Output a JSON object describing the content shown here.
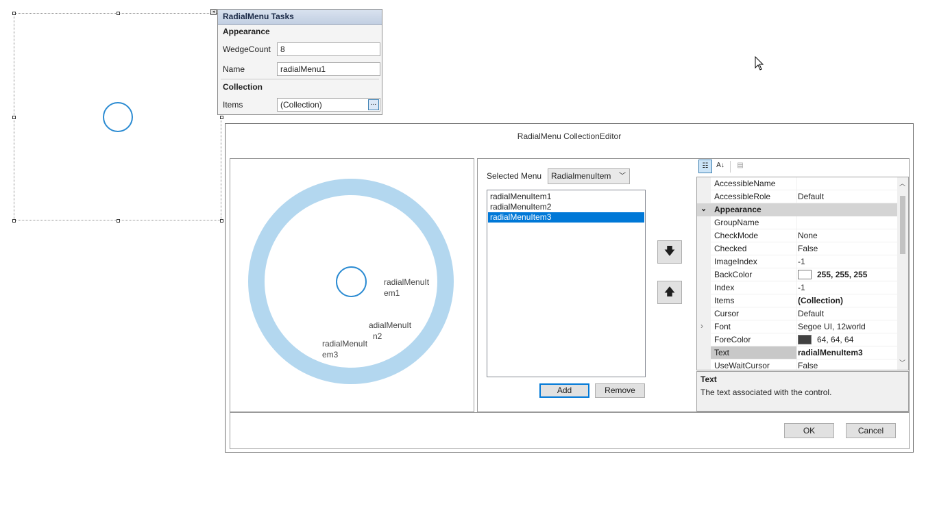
{
  "tasks_panel": {
    "title": "RadialMenu Tasks",
    "appearance_header": "Appearance",
    "wedge_count_label": "WedgeCount",
    "wedge_count_value": "8",
    "name_label": "Name",
    "name_value": "radialMenu1",
    "collection_header": "Collection",
    "items_label": "Items",
    "items_value": "(Collection)",
    "ellipsis": "..."
  },
  "dialog": {
    "title": "RadialMenu CollectionEditor",
    "preview_labels": [
      {
        "line1": "radialMenuIt",
        "line2": "em1"
      },
      {
        "line1": "adialMenuIt",
        "line2": "n2"
      },
      {
        "line1": "radialMenuIt",
        "line2": "em3"
      }
    ],
    "selected_menu_label": "Selected Menu",
    "selected_menu_value": "RadialmenuItem",
    "list_items": [
      "radialMenuItem1",
      "radialMenuItem2",
      "radialMenuItem3"
    ],
    "selected_index": 2,
    "add_label": "Add",
    "remove_label": "Remove",
    "move_down_symbol": "🡇",
    "move_up_symbol": "🡅",
    "ok_label": "OK",
    "cancel_label": "Cancel"
  },
  "property_grid": {
    "rows": [
      {
        "name": "AccessibleName",
        "value": ""
      },
      {
        "name": "AccessibleRole",
        "value": "Default"
      },
      {
        "category": "Appearance"
      },
      {
        "name": "GroupName",
        "value": ""
      },
      {
        "name": "CheckMode",
        "value": "None"
      },
      {
        "name": "Checked",
        "value": "False"
      },
      {
        "name": "ImageIndex",
        "value": "-1"
      },
      {
        "name": "BackColor",
        "value": "255, 255, 255",
        "swatch": "#ffffff",
        "bold": true
      },
      {
        "name": "Index",
        "value": "-1"
      },
      {
        "name": "Items",
        "value": "(Collection)",
        "bold": true
      },
      {
        "name": "Cursor",
        "value": "Default"
      },
      {
        "name": "Font",
        "value": "Segoe UI, 12world",
        "expandable": true
      },
      {
        "name": "ForeColor",
        "value": "64, 64, 64",
        "swatch": "#404040"
      },
      {
        "name": "Text",
        "value": "radialMenuItem3",
        "bold": true,
        "selected": true
      },
      {
        "name": "UseWaitCursor",
        "value": "False"
      }
    ],
    "description_title": "Text",
    "description_text": "The text associated with the control."
  },
  "colors": {
    "accent": "#0078d7",
    "ring": "#b3d7ef",
    "circle": "#2b8bd2"
  }
}
